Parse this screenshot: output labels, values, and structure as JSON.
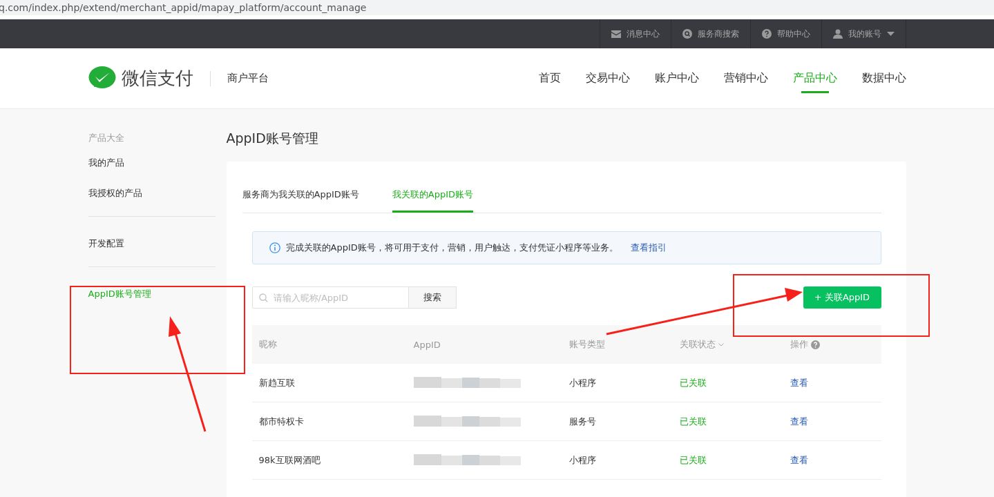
{
  "address_bar": {
    "url": "q.com/index.php/extend/merchant_appid/mapay_platform/account_manage"
  },
  "top_bar": {
    "items": [
      {
        "kind": "mail",
        "label": "消息中心"
      },
      {
        "kind": "search",
        "label": "服务商搜索"
      },
      {
        "kind": "help",
        "label": "帮助中心"
      },
      {
        "kind": "account",
        "label": "我的账号"
      }
    ]
  },
  "header": {
    "logo_text": "微信支付",
    "platform": "商户平台",
    "nav": [
      {
        "label": "首页",
        "selected": false
      },
      {
        "label": "交易中心",
        "selected": false
      },
      {
        "label": "账户中心",
        "selected": false
      },
      {
        "label": "营销中心",
        "selected": false
      },
      {
        "label": "产品中心",
        "selected": true
      },
      {
        "label": "数据中心",
        "selected": false
      }
    ]
  },
  "sidebar": {
    "heading": "产品大全",
    "groups": [
      [
        {
          "label": "我的产品",
          "selected": false
        },
        {
          "label": "我授权的产品",
          "selected": false
        }
      ],
      [
        {
          "label": "开发配置",
          "selected": false
        }
      ],
      [
        {
          "label": "AppID账号管理",
          "selected": true
        }
      ]
    ]
  },
  "page_title": "AppID账号管理",
  "tabs": [
    {
      "label": "服务商为我关联的AppID账号",
      "selected": false
    },
    {
      "label": "我关联的AppID账号",
      "selected": true
    }
  ],
  "notice": {
    "text": "完成关联的AppID账号，将可用于支付，营销，用户触达，支付凭证小程序等业务。",
    "link": "查看指引"
  },
  "search": {
    "placeholder": "请输入昵称/AppID",
    "button": "搜索"
  },
  "add_button": "+ 关联AppID",
  "table": {
    "columns": [
      {
        "label": "昵称",
        "kind": "plain"
      },
      {
        "label": "AppID",
        "kind": "plain"
      },
      {
        "label": "账号类型",
        "kind": "plain"
      },
      {
        "label": "关联状态",
        "kind": "sort"
      },
      {
        "label": "操作",
        "kind": "help"
      }
    ],
    "rows": [
      {
        "nickname": "新趋互联",
        "type": "小程序",
        "status": "已关联",
        "action": "查看"
      },
      {
        "nickname": "都市特权卡",
        "type": "服务号",
        "status": "已关联",
        "action": "查看"
      },
      {
        "nickname": "98k互联网酒吧",
        "type": "小程序",
        "status": "已关联",
        "action": "查看"
      }
    ]
  }
}
